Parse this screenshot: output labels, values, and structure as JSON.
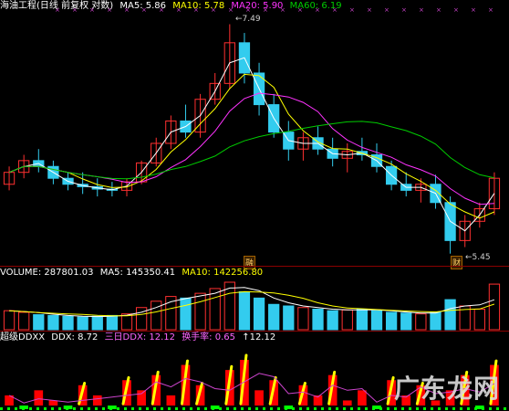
{
  "main_header": {
    "title": "海油工程(日线 前复权 对数)",
    "ma5": "MA5: 5.86",
    "ma10": "MA10: 5.78",
    "ma20": "MA20: 5.90",
    "ma60": "MA60: 6.19"
  },
  "volume_header": {
    "volume": "VOLUME: 287801.03",
    "ma5": "MA5: 145350.41",
    "ma10": "MA10: 142256.80"
  },
  "ddx_header": {
    "name": "超级DDXX",
    "ddx": "DDX: 8.72",
    "three_day": "三日DDX: 12.12",
    "turnover": "换手率: 0.65",
    "extra": "↑12.12"
  },
  "annotations": {
    "high": "←7.49",
    "low": "←5.45",
    "marker_1": "融",
    "marker_2": "财"
  },
  "watermark": "广东龙网",
  "colors": {
    "up": "#ff3030",
    "down": "#33ccee",
    "ma5": "#ffffff",
    "ma10": "#ffff00",
    "ma20": "#ff33ff",
    "ma60": "#00cc00",
    "title": "#ffffff",
    "turnover": "#ff66ff",
    "ddx_bar_up": "#ff0000",
    "ddx_bar_down": "#00ff00",
    "ddx_line": "#ffff00"
  },
  "chart_data": {
    "type": "candlestick",
    "candles_sampled": [
      [
        6.0,
        6.15,
        5.95,
        6.1
      ],
      [
        6.1,
        6.25,
        6.05,
        6.2
      ],
      [
        6.2,
        6.3,
        6.1,
        6.15
      ],
      [
        6.15,
        6.2,
        6.0,
        6.05
      ],
      [
        6.05,
        6.1,
        5.95,
        6.0
      ],
      [
        6.0,
        6.1,
        5.92,
        5.98
      ],
      [
        5.98,
        6.05,
        5.9,
        5.96
      ],
      [
        5.96,
        6.02,
        5.9,
        5.95
      ],
      [
        5.95,
        6.05,
        5.9,
        6.02
      ],
      [
        6.02,
        6.2,
        6.0,
        6.18
      ],
      [
        6.18,
        6.4,
        6.15,
        6.35
      ],
      [
        6.35,
        6.6,
        6.3,
        6.55
      ],
      [
        6.55,
        6.7,
        6.4,
        6.45
      ],
      [
        6.45,
        6.8,
        6.4,
        6.75
      ],
      [
        6.75,
        7.0,
        6.7,
        6.9
      ],
      [
        6.9,
        7.49,
        6.85,
        7.3
      ],
      [
        7.3,
        7.4,
        6.9,
        7.0
      ],
      [
        7.0,
        7.1,
        6.6,
        6.7
      ],
      [
        6.7,
        6.8,
        6.4,
        6.45
      ],
      [
        6.45,
        6.55,
        6.2,
        6.3
      ],
      [
        6.3,
        6.45,
        6.2,
        6.4
      ],
      [
        6.4,
        6.5,
        6.25,
        6.3
      ],
      [
        6.3,
        6.4,
        6.15,
        6.22
      ],
      [
        6.22,
        6.35,
        6.1,
        6.28
      ],
      [
        6.28,
        6.4,
        6.2,
        6.25
      ],
      [
        6.25,
        6.35,
        6.1,
        6.15
      ],
      [
        6.15,
        6.2,
        5.95,
        6.0
      ],
      [
        6.0,
        6.1,
        5.9,
        5.95
      ],
      [
        5.95,
        6.05,
        5.85,
        6.0
      ],
      [
        6.0,
        6.08,
        5.8,
        5.85
      ],
      [
        5.85,
        5.9,
        5.45,
        5.55
      ],
      [
        5.55,
        5.75,
        5.5,
        5.7
      ],
      [
        5.7,
        5.85,
        5.65,
        5.8
      ],
      [
        5.8,
        6.1,
        5.75,
        6.05
      ]
    ],
    "price_range": [
      5.4,
      7.6
    ],
    "volume_ma_labels": [
      "MA5",
      "MA10"
    ],
    "volume_sampled": [
      120,
      110,
      95,
      90,
      85,
      80,
      85,
      90,
      100,
      140,
      180,
      210,
      200,
      230,
      260,
      300,
      240,
      200,
      160,
      150,
      140,
      130,
      120,
      125,
      130,
      120,
      110,
      105,
      100,
      110,
      190,
      150,
      130,
      288
    ],
    "ddx_sampled": [
      2,
      -1,
      3,
      1,
      -2,
      4,
      2,
      -1,
      5,
      3,
      6,
      2,
      8,
      4,
      -2,
      7,
      9,
      3,
      5,
      -1,
      4,
      2,
      6,
      1,
      3,
      -2,
      5,
      2,
      4,
      1,
      3,
      6,
      -1,
      8
    ]
  }
}
